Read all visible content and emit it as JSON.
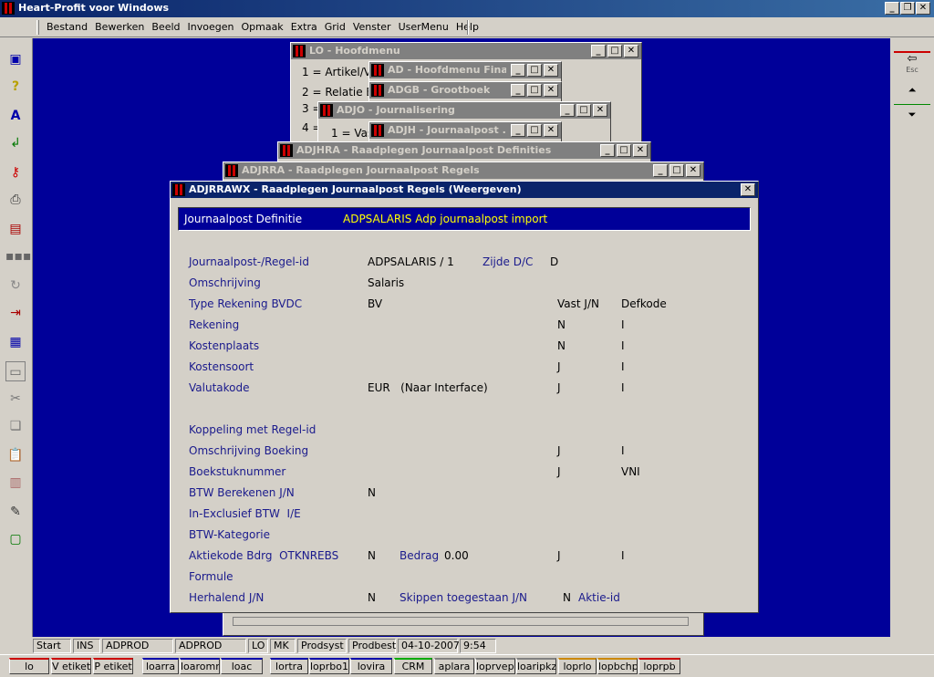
{
  "app": {
    "title": "Heart-Profit voor Windows"
  },
  "menu": [
    "Bestand",
    "Bewerken",
    "Beeld",
    "Invoegen",
    "Opmaak",
    "Extra",
    "Grid",
    "Venster",
    "UserMenu",
    "Help"
  ],
  "windows": {
    "lo": "LO - Hoofdmenu",
    "ad": "AD - Hoofdmenu Fina...",
    "adgb": "ADGB - Grootboek",
    "adjo": "ADJO - Journalisering",
    "adjh": "ADJH - Journaalpost ...",
    "adjhra": "ADJHRA - Raadplegen Journaalpost Definities",
    "adjrra": "ADJRRA - Raadplegen Journaalpost Regels",
    "main": "ADJRRAWX - Raadplegen Journaalpost Regels (Weergeven)"
  },
  "lo_items": [
    "1 = Artikel/Voo",
    "2 = Relatie Be",
    "3 =",
    "4 ="
  ],
  "adjo_item": "1 = Vas",
  "header": {
    "label": "Journaalpost Definitie",
    "value": "ADPSALARIS  Adp journaalpost import"
  },
  "fields": {
    "regel_id_label": "Journaalpost-/Regel-id",
    "regel_id_value": "ADPSALARIS / 1",
    "zijde_label": "Zijde D/C",
    "zijde_value": "D",
    "omschrijving_label": "Omschrijving",
    "omschrijving_value": "Salaris",
    "type_label": "Type Rekening BVDC",
    "type_value": "BV",
    "vast_header": "Vast J/N",
    "defkode_header": "Defkode",
    "rekening_label": "Rekening",
    "rekening_vast": "N",
    "rekening_def": "I",
    "kostenplaats_label": "Kostenplaats",
    "kostenplaats_vast": "N",
    "kostenplaats_def": "I",
    "kostensoort_label": "Kostensoort",
    "kostensoort_vast": "J",
    "kostensoort_def": "I",
    "valutakode_label": "Valutakode",
    "valutakode_value": "EUR   (Naar Interface)",
    "valutakode_vast": "J",
    "valutakode_def": "I",
    "koppeling_label": "Koppeling met Regel-id",
    "omschr_boeking_label": "Omschrijving Boeking",
    "omschr_boeking_vast": "J",
    "omschr_boeking_def": "I",
    "boekstuk_label": "Boekstuknummer",
    "boekstuk_vast": "J",
    "boekstuk_def": "VNI",
    "btw_ber_label": "BTW Berekenen J/N",
    "btw_ber_value": "N",
    "inexcl_label": "In-Exclusief BTW  I/E",
    "btw_kat_label": "BTW-Kategorie",
    "aktiekode_label": "Aktiekode Bdrg  OTKNREBS",
    "aktiekode_value": "N",
    "bedrag_label": "Bedrag",
    "bedrag_value": "0.00",
    "aktiekode_vast": "J",
    "aktiekode_def": "I",
    "formule_label": "Formule",
    "herhalend_label": "Herhalend J/N",
    "herhalend_value": "N",
    "skippen_label": "Skippen toegestaan J/N",
    "skippen_value": "N",
    "aktie_id_label": "Aktie-id"
  },
  "status": [
    "Start",
    "INS",
    "ADPROD",
    "ADPROD",
    "LO",
    "MK",
    "Prodsyst",
    "Prodbest",
    "04-10-2007",
    "9:54"
  ],
  "taskbar": [
    "lo",
    "V etiket",
    "P etiket",
    "loarra",
    "loaromra",
    "loac",
    "lortra",
    "loprbo1",
    "lovira",
    "CRM",
    "aplara",
    "loprvepr",
    "loaripkz",
    "loprlo",
    "lopbchpr",
    "loprpb"
  ],
  "right_toolbar": {
    "esc": "Esc"
  }
}
